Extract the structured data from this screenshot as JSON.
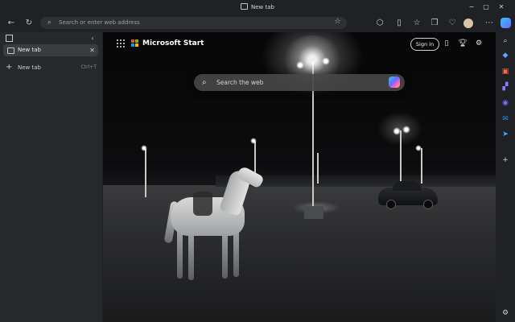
{
  "window": {
    "title": "New tab",
    "controls": {
      "minimize": "−",
      "maximize": "▢",
      "close": "✕"
    }
  },
  "toolbar": {
    "back_icon": "←",
    "refresh_icon": "↻",
    "address_placeholder": "Search or enter web address",
    "right_icons": [
      "extensions-icon",
      "split-screen-icon",
      "favorites-icon",
      "collections-icon",
      "browser-essentials-icon",
      "profile-icon",
      "more-icon"
    ]
  },
  "sidepane": {
    "tabs": [
      {
        "label": "New tab",
        "active": true
      }
    ],
    "new_tab": {
      "label": "New tab",
      "shortcut": "Ctrl+T"
    }
  },
  "ntp": {
    "brand": "Microsoft Start",
    "signin_label": "Sign in",
    "search_placeholder": "Search the web"
  },
  "right_sidebar": {
    "items": [
      "copilot-icon",
      "search-icon",
      "shopping-icon",
      "tools-icon",
      "games-icon",
      "outlook-icon",
      "telegram-icon",
      "add-icon",
      "settings-icon"
    ]
  },
  "colors": {
    "chrome_bg": "#202124",
    "sidepane_bg": "#27282b",
    "active_tab_bg": "#3b3c40",
    "accent": "#37a0ff"
  }
}
